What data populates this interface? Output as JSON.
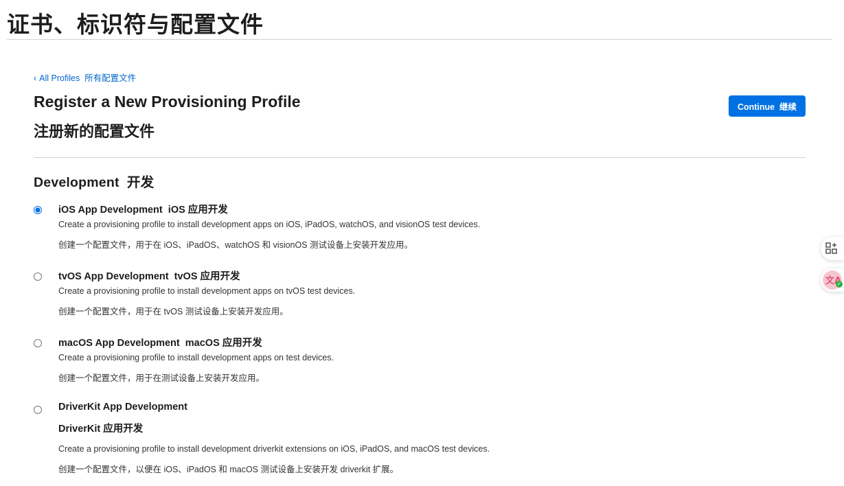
{
  "page_header": {
    "title": "证书、标识符与配置文件"
  },
  "breadcrumb": {
    "chevron": "‹",
    "label": "All Profiles  所有配置文件"
  },
  "heading": {
    "title_en": "Register a New Provisioning Profile",
    "title_zh": "注册新的配置文件"
  },
  "continue_button": {
    "label": "Continue  继续"
  },
  "section": {
    "title": "Development  开发"
  },
  "options": [
    {
      "id": "ios",
      "selected": true,
      "title": "iOS App Development  iOS 应用开发",
      "desc_en": "Create a provisioning profile to install development apps on iOS, iPadOS, watchOS, and visionOS test devices.",
      "desc_zh": "创建一个配置文件，用于在 iOS、iPadOS、watchOS 和 visionOS 测试设备上安装开发应用。"
    },
    {
      "id": "tvos",
      "selected": false,
      "title": "tvOS App Development  tvOS 应用开发",
      "desc_en": "Create a provisioning profile to install development apps on tvOS test devices.",
      "desc_zh": "创建一个配置文件，用于在 tvOS 测试设备上安装开发应用。"
    },
    {
      "id": "macos",
      "selected": false,
      "title": "macOS App Development  macOS 应用开发",
      "desc_en": "Create a provisioning profile to install development apps on test devices.",
      "desc_zh": "创建一个配置文件，用于在测试设备上安装开发应用。"
    },
    {
      "id": "driverkit",
      "selected": false,
      "title": "DriverKit App Development",
      "title_zh": "DriverKit 应用开发",
      "desc_en": "Create a provisioning profile to install development driverkit extensions on iOS, iPadOS, and macOS test devices.",
      "desc_zh": "创建一个配置文件，以便在 iOS、iPadOS 和 macOS 测试设备上安装开发 driverkit 扩展。"
    }
  ],
  "side_tools": {
    "apps_icon": "grid-plus-icon",
    "translate_icon": "translate-icon",
    "translate_glyph": "文A",
    "check_glyph": "✓"
  },
  "colors": {
    "accent": "#0071e3",
    "link": "#0066cc",
    "text": "#1d1d1f",
    "divider": "#d2d2d7"
  }
}
